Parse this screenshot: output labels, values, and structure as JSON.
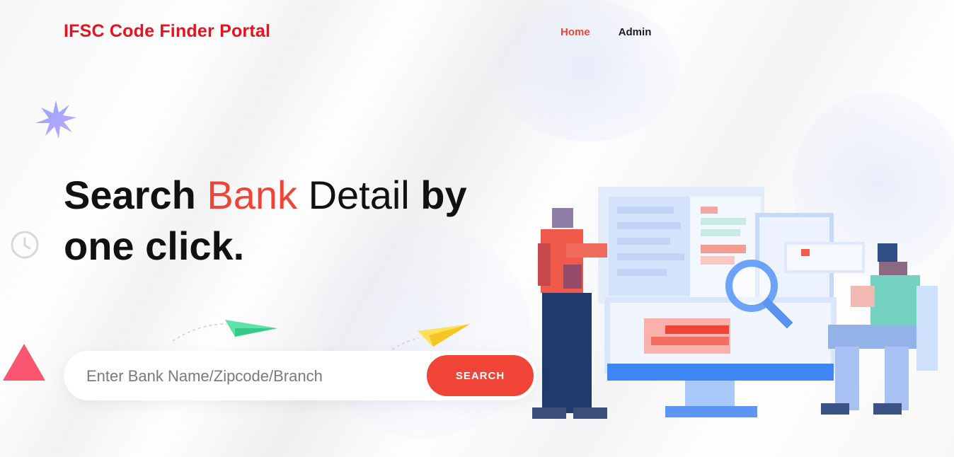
{
  "header": {
    "brand": "IFSC Code Finder Portal",
    "nav": [
      {
        "label": "Home",
        "active": true
      },
      {
        "label": "Admin",
        "active": false
      }
    ]
  },
  "hero": {
    "title_part1": "Search",
    "title_accent": "Bank",
    "title_part2": "Detail",
    "title_part3": "by",
    "title_line2": "one click."
  },
  "search": {
    "placeholder": "Enter Bank Name/Zipcode/Branch",
    "value": "",
    "button_label": "SEARCH"
  },
  "colors": {
    "brand": "#e5121f",
    "accent": "#ef4436",
    "text": "#111111"
  },
  "icons": {
    "star": "starburst-icon",
    "clock": "clock-icon",
    "triangle": "triangle-icon",
    "plane_green": "paper-plane-icon",
    "plane_yellow": "paper-plane-icon"
  }
}
